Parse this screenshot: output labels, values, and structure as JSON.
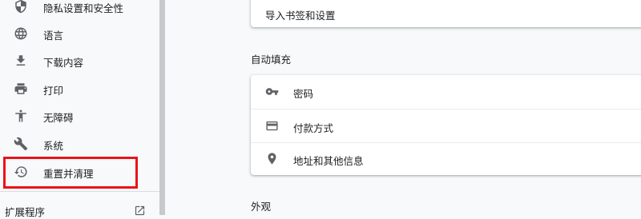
{
  "sidebar": {
    "items": [
      {
        "label": "隐私设置和安全性",
        "icon": "shield-icon"
      },
      {
        "label": "语言",
        "icon": "globe-icon"
      },
      {
        "label": "下载内容",
        "icon": "download-icon"
      },
      {
        "label": "打印",
        "icon": "printer-icon"
      },
      {
        "label": "无障碍",
        "icon": "accessibility-icon"
      },
      {
        "label": "系统",
        "icon": "wrench-icon"
      },
      {
        "label": "重置并清理",
        "icon": "restore-icon"
      }
    ],
    "extensions_label": "扩展程序",
    "extensions_icon": "open-in-new-icon",
    "highlight_color": "#e8141a"
  },
  "main": {
    "import_row_label": "导入书签和设置",
    "autofill": {
      "title": "自动填充",
      "rows": [
        {
          "label": "密码",
          "icon": "key-icon"
        },
        {
          "label": "付款方式",
          "icon": "credit-card-icon"
        },
        {
          "label": "地址和其他信息",
          "icon": "location-pin-icon"
        }
      ]
    },
    "appearance_title": "外观"
  }
}
